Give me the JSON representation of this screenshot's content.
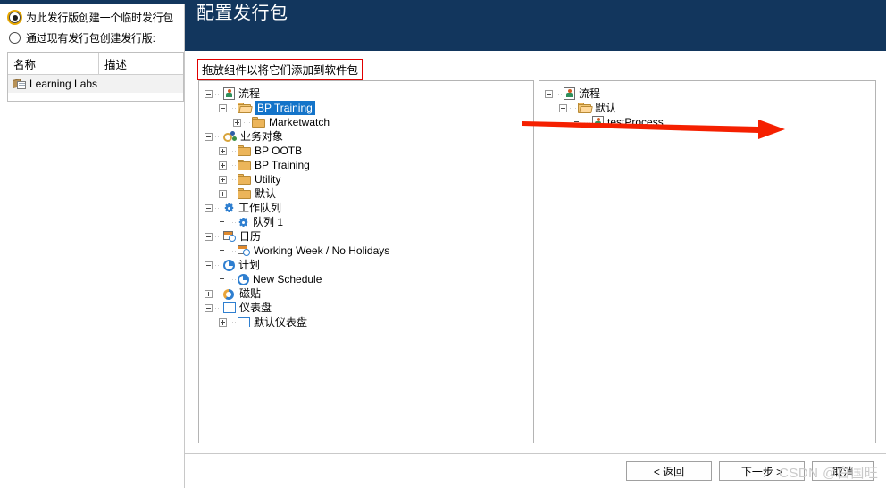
{
  "window": {
    "title": "配置发行包"
  },
  "sidebar": {
    "options": [
      {
        "label": "为此发行版创建一个临时发行包",
        "selected": true,
        "focused": true
      },
      {
        "label": "通过现有发行包创建发行版:",
        "selected": false,
        "focused": false
      }
    ],
    "table": {
      "columns": [
        "名称",
        "描述"
      ],
      "rows": [
        {
          "icon": "package-icon",
          "name": "Learning Labs",
          "description": ""
        }
      ]
    }
  },
  "main": {
    "hint": "拖放组件以将它们添加到软件包",
    "left_tree": {
      "nodes": [
        {
          "label": "流程",
          "indent": 0,
          "toggle": "minus",
          "icon": "process-icon",
          "selected": false
        },
        {
          "label": "BP Training",
          "indent": 1,
          "toggle": "minus",
          "icon": "folder-open-icon",
          "selected": true
        },
        {
          "label": "Marketwatch",
          "indent": 2,
          "toggle": "plus",
          "icon": "folder-icon",
          "selected": false
        },
        {
          "label": "业务对象",
          "indent": 0,
          "toggle": "minus",
          "icon": "business-object-icon",
          "selected": false
        },
        {
          "label": "BP OOTB",
          "indent": 1,
          "toggle": "plus",
          "icon": "folder-icon",
          "selected": false
        },
        {
          "label": "BP Training",
          "indent": 1,
          "toggle": "plus",
          "icon": "folder-icon",
          "selected": false
        },
        {
          "label": "Utility",
          "indent": 1,
          "toggle": "plus",
          "icon": "folder-icon",
          "selected": false
        },
        {
          "label": "默认",
          "indent": 1,
          "toggle": "plus",
          "icon": "folder-icon",
          "selected": false
        },
        {
          "label": "工作队列",
          "indent": 0,
          "toggle": "minus",
          "icon": "gear-icon",
          "selected": false
        },
        {
          "label": "队列 1",
          "indent": 1,
          "toggle": "none",
          "icon": "gear-icon",
          "selected": false
        },
        {
          "label": "日历",
          "indent": 0,
          "toggle": "minus",
          "icon": "calendar-icon",
          "selected": false
        },
        {
          "label": "Working Week / No Holidays",
          "indent": 1,
          "toggle": "none",
          "icon": "calendar-icon",
          "selected": false
        },
        {
          "label": "计划",
          "indent": 0,
          "toggle": "minus",
          "icon": "clock-icon",
          "selected": false
        },
        {
          "label": "New Schedule",
          "indent": 1,
          "toggle": "none",
          "icon": "clock-icon",
          "selected": false
        },
        {
          "label": "磁贴",
          "indent": 0,
          "toggle": "plus",
          "icon": "tile-icon",
          "selected": false
        },
        {
          "label": "仪表盘",
          "indent": 0,
          "toggle": "minus",
          "icon": "dashboard-icon",
          "selected": false
        },
        {
          "label": "默认仪表盘",
          "indent": 1,
          "toggle": "plus",
          "icon": "dashboard-icon",
          "selected": false
        }
      ]
    },
    "right_tree": {
      "nodes": [
        {
          "label": "流程",
          "indent": 0,
          "toggle": "minus",
          "icon": "process-icon",
          "selected": false
        },
        {
          "label": "默认",
          "indent": 1,
          "toggle": "minus",
          "icon": "folder-open-icon",
          "selected": false
        },
        {
          "label": "testProcess",
          "indent": 2,
          "toggle": "none",
          "icon": "process-icon",
          "selected": false
        }
      ]
    },
    "annotation": {
      "arrow_color": "#f52000"
    }
  },
  "footer": {
    "back_label": "< 返回",
    "next_label": "下一步 >",
    "cancel_label": "取消"
  },
  "watermark": {
    "text": "CSDN @白国旺"
  }
}
